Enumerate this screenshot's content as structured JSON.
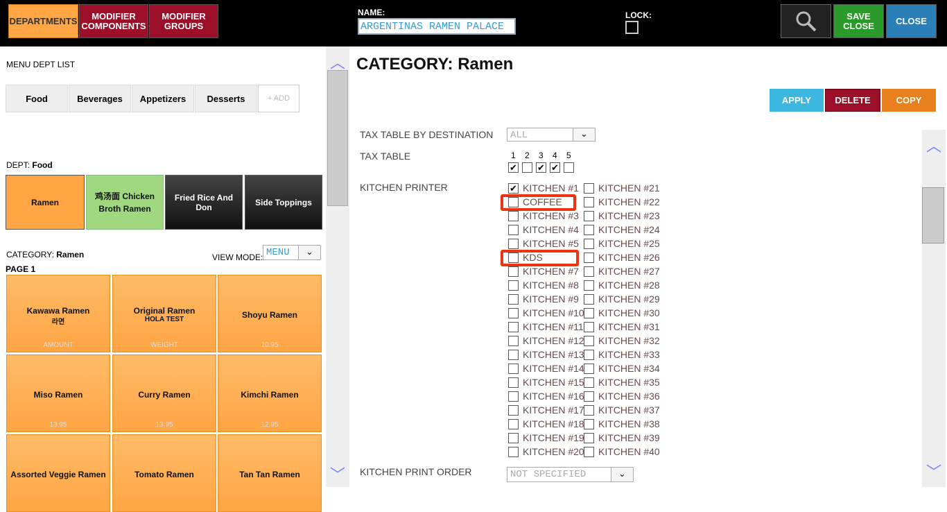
{
  "top": {
    "departments": "DEPARTMENTS",
    "modifier_components": "MODIFIER COMPONENTS",
    "modifier_groups": "MODIFIER GROUPS",
    "name_label": "NAME:",
    "name_value": "ARGENTINAS RAMEN PALACE",
    "lock_label": "LOCK:",
    "save_close": "SAVE CLOSE",
    "close": "CLOSE",
    "search_icon": "magnifier-icon"
  },
  "left": {
    "menu_dept_list": "MENU DEPT LIST",
    "depts": [
      "Food",
      "Beverages",
      "Appetizers",
      "Desserts"
    ],
    "add": "+ ADD",
    "dept_label": "DEPT:",
    "dept_value": "Food",
    "categories": [
      "Ramen",
      "鸡汤面 Chicken Broth Ramen",
      "Fried Rice And Don",
      "Side Toppings"
    ],
    "category_label": "CATEGORY:",
    "category_value": "Ramen",
    "view_mode_label": "VIEW MODE:",
    "view_mode_value": "MENU",
    "page_label": "PAGE 1",
    "items": [
      {
        "name": "Kawawa Ramen",
        "sub": "라면",
        "price": "AMOUNT"
      },
      {
        "name": "Original Ramen",
        "sub": "HOLA TEST",
        "price": "WEIGHT"
      },
      {
        "name": "Shoyu Ramen",
        "sub": "",
        "price": "10.95"
      },
      {
        "name": "Miso Ramen",
        "sub": "",
        "price": "13.95"
      },
      {
        "name": "Curry Ramen",
        "sub": "",
        "price": "13.95"
      },
      {
        "name": "Kimchi Ramen",
        "sub": "",
        "price": "12.95"
      },
      {
        "name": "Assorted Veggie Ramen",
        "sub": "",
        "price": ""
      },
      {
        "name": "Tomato Ramen",
        "sub": "",
        "price": ""
      },
      {
        "name": "Tan Tan Ramen",
        "sub": "",
        "price": ""
      }
    ]
  },
  "right": {
    "title": "CATEGORY: Ramen",
    "apply": "APPLY",
    "delete": "DELETE",
    "copy": "COPY",
    "tax_table_by_dest_label": "TAX TABLE BY DESTINATION",
    "tax_table_by_dest_value": "ALL",
    "tax_table_label": "TAX TABLE",
    "tax_cols": [
      "1",
      "2",
      "3",
      "4",
      "5"
    ],
    "tax_checked": [
      true,
      false,
      true,
      true,
      false
    ],
    "kitchen_printer_label": "KITCHEN PRINTER",
    "printers_col1": [
      "KITCHEN #1",
      "COFFEE",
      "KITCHEN #3",
      "KITCHEN #4",
      "KITCHEN #5",
      "KDS",
      "KITCHEN #7",
      "KITCHEN #8",
      "KITCHEN #9",
      "KITCHEN #10",
      "KITCHEN #11",
      "KITCHEN #12",
      "KITCHEN #13",
      "KITCHEN #14",
      "KITCHEN #15",
      "KITCHEN #16",
      "KITCHEN #17",
      "KITCHEN #18",
      "KITCHEN #19",
      "KITCHEN #20"
    ],
    "printers_col2": [
      "KITCHEN #21",
      "KITCHEN #22",
      "KITCHEN #23",
      "KITCHEN #24",
      "KITCHEN #25",
      "KITCHEN #26",
      "KITCHEN #27",
      "KITCHEN #28",
      "KITCHEN #29",
      "KITCHEN #30",
      "KITCHEN #31",
      "KITCHEN #32",
      "KITCHEN #33",
      "KITCHEN #34",
      "KITCHEN #35",
      "KITCHEN #36",
      "KITCHEN #37",
      "KITCHEN #38",
      "KITCHEN #39",
      "KITCHEN #40"
    ],
    "kitchen_print_order_label": "KITCHEN PRINT ORDER",
    "kitchen_print_order_value": "NOT SPECIFIED"
  },
  "colors": {
    "orange": "#ffa544",
    "maroon": "#9b1028",
    "green": "#2a9a2a",
    "blue": "#2a7fb8",
    "apply": "#3cb8e0",
    "copy": "#e8801e"
  }
}
